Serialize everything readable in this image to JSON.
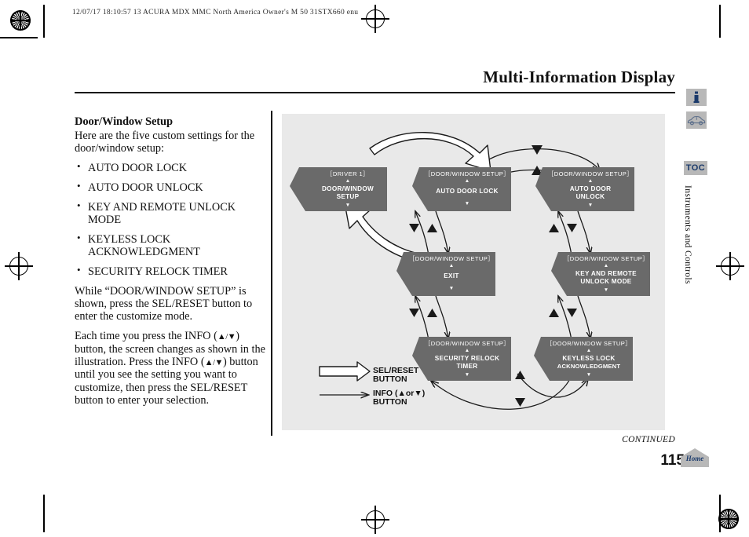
{
  "header": {
    "print_stamp": "12/07/17 18:10:57    13 ACURA MDX MMC North America Owner's M 50 31STX660 enu",
    "title": "Multi-Information Display"
  },
  "content": {
    "heading": "Door/Window Setup",
    "intro": "Here are the five custom settings for the door/window setup:",
    "bullets": [
      "AUTO DOOR LOCK",
      "AUTO DOOR UNLOCK",
      "KEY AND REMOTE UNLOCK MODE",
      "KEYLESS LOCK ACKNOWLEDGMENT",
      "SECURITY RELOCK TIMER"
    ],
    "paragraph_1": "While “DOOR/WINDOW SETUP” is shown, press the SEL/RESET button to enter the customize mode.",
    "paragraph_2_a": "Each time you press the INFO (",
    "paragraph_2_tri1": "▲/▼",
    "paragraph_2_b": ") button, the screen changes as shown in the illustration. Press the INFO (",
    "paragraph_2_tri2": "▲/▼",
    "paragraph_2_c": ") button until you see the setting you want to customize, then press the SEL/RESET button to enter your selection."
  },
  "figure": {
    "screens": [
      {
        "id": "driver1",
        "header": "［DRIVER 1］",
        "lines": [
          "DOOR/WINDOW",
          "SETUP"
        ]
      },
      {
        "id": "autolock",
        "header": "［DOOR/WINDOW SETUP］",
        "lines": [
          "AUTO DOOR LOCK"
        ]
      },
      {
        "id": "autounlock",
        "header": "［DOOR/WINDOW SETUP］",
        "lines": [
          "AUTO DOOR",
          "UNLOCK"
        ]
      },
      {
        "id": "exit",
        "header": "［DOOR/WINDOW SETUP］",
        "lines": [
          "EXIT"
        ]
      },
      {
        "id": "keyremote",
        "header": "［DOOR/WINDOW SETUP］",
        "lines": [
          "KEY AND REMOTE",
          "UNLOCK MODE"
        ]
      },
      {
        "id": "relock",
        "header": "［DOOR/WINDOW SETUP］",
        "lines": [
          "SECURITY RELOCK",
          "TIMER"
        ]
      },
      {
        "id": "keyless",
        "header": "［DOOR/WINDOW SETUP］",
        "lines": [
          "KEYLESS LOCK",
          "ACKNOWLEDGMENT"
        ]
      }
    ],
    "legend": {
      "sel_line1": "SEL/RESET",
      "sel_line2": "BUTTON",
      "info_line1": "INFO (▲or▼)",
      "info_line2": "BUTTON"
    },
    "colors": {
      "panel_bg": "#e9e9e9",
      "screen_fill": "#6a6a6a",
      "screen_text": "#ffffff",
      "arrow": "#1a1a1a"
    }
  },
  "sidebar": {
    "info_icon": "info-icon",
    "vehicle_icon": "vehicle-icon",
    "toc_label": "TOC",
    "section_label": "Instruments and Controls"
  },
  "footer": {
    "continued": "CONTINUED",
    "page_number": "115",
    "home_label": "Home"
  }
}
